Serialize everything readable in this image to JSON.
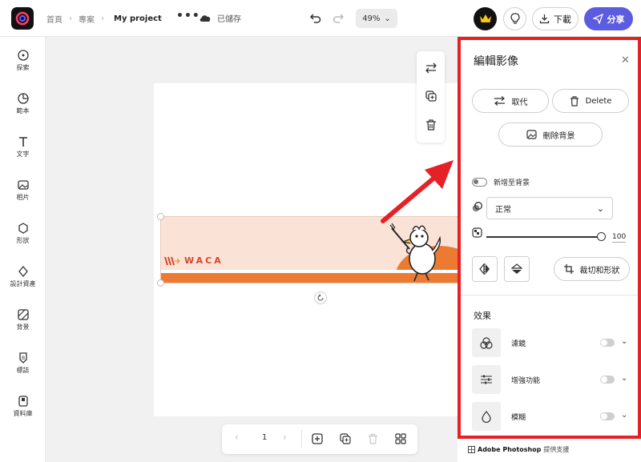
{
  "header": {
    "breadcrumbs": [
      "首頁",
      "專案"
    ],
    "project_name": "My project",
    "more": "•••",
    "saved_status": "已儲存",
    "zoom": "49%",
    "download_label": "下載",
    "share_label": "分享"
  },
  "sidebar": {
    "items": [
      {
        "label": "探索",
        "icon": "discover-icon"
      },
      {
        "label": "範本",
        "icon": "templates-icon"
      },
      {
        "label": "文字",
        "icon": "text-icon"
      },
      {
        "label": "相片",
        "icon": "photos-icon"
      },
      {
        "label": "形狀",
        "icon": "shapes-icon"
      },
      {
        "label": "設計資產",
        "icon": "design-assets-icon"
      },
      {
        "label": "背景",
        "icon": "background-icon"
      },
      {
        "label": "標誌",
        "icon": "logo-icon"
      },
      {
        "label": "資料庫",
        "icon": "library-icon"
      }
    ]
  },
  "canvas": {
    "banner_brand": "WACA",
    "page_number": "1"
  },
  "panel": {
    "title": "編輯影像",
    "replace_label": "取代",
    "delete_label": "Delete",
    "remove_bg_label": "刪除背景",
    "add_to_bg_label": "新增至背景",
    "blend_mode": "正常",
    "opacity": 100,
    "opacity_label": "100",
    "crop_label": "裁切和形狀",
    "effects_title": "效果",
    "effects": [
      {
        "label": "濾鏡",
        "enabled": false
      },
      {
        "label": "增強功能",
        "enabled": false
      },
      {
        "label": "模糊",
        "enabled": false
      }
    ]
  },
  "footer": {
    "powered_brand": "Adobe Photoshop",
    "powered_suffix": "提供支援"
  },
  "colors": {
    "accent": "#5c5ce0",
    "highlight_border": "#e52127",
    "banner_orange": "#ec7a33",
    "banner_peach": "#fae3d6"
  }
}
